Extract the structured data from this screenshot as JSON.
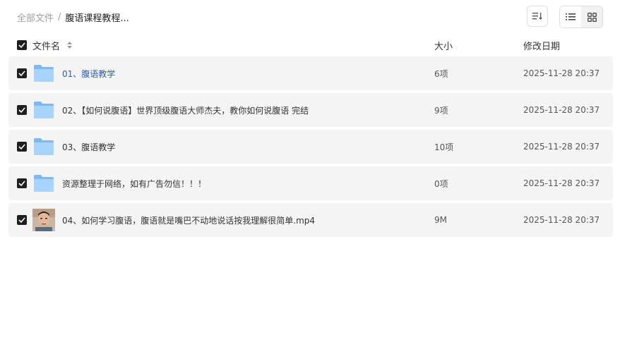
{
  "breadcrumb": {
    "root": "全部文件",
    "separator": "/",
    "current": "腹语课程教程..."
  },
  "toolbar": {
    "sort_icon": "sort-lines-icon",
    "list_view_icon": "list-view-icon",
    "grid_view_icon": "grid-view-icon"
  },
  "table": {
    "headers": {
      "name": "文件名",
      "size": "大小",
      "date": "修改日期"
    },
    "rows": [
      {
        "name": "01、腹语教学",
        "size": "6项",
        "date": "2025-11-28 20:37",
        "type": "folder"
      },
      {
        "name": "02、【如何说腹语】世界顶级腹语大师杰夫，教你如何说腹语 完结",
        "size": "9项",
        "date": "2025-11-28 20:37",
        "type": "folder"
      },
      {
        "name": "03、腹语教学",
        "size": "10项",
        "date": "2025-11-28 20:37",
        "type": "folder"
      },
      {
        "name": "资源整理于网络，如有广告勿信！！！",
        "size": "0项",
        "date": "2025-11-28 20:37",
        "type": "folder"
      },
      {
        "name": "04、如何学习腹语，腹语就是嘴巴不动地说话按我理解很简单.mp4",
        "size": "9M",
        "date": "2025-11-28 20:37",
        "type": "video"
      }
    ]
  },
  "colors": {
    "checkbox": "#1f1f1f",
    "row_bg": "#f4f4f5",
    "link": "#2a5db0",
    "folder": "#8ec5f5"
  }
}
